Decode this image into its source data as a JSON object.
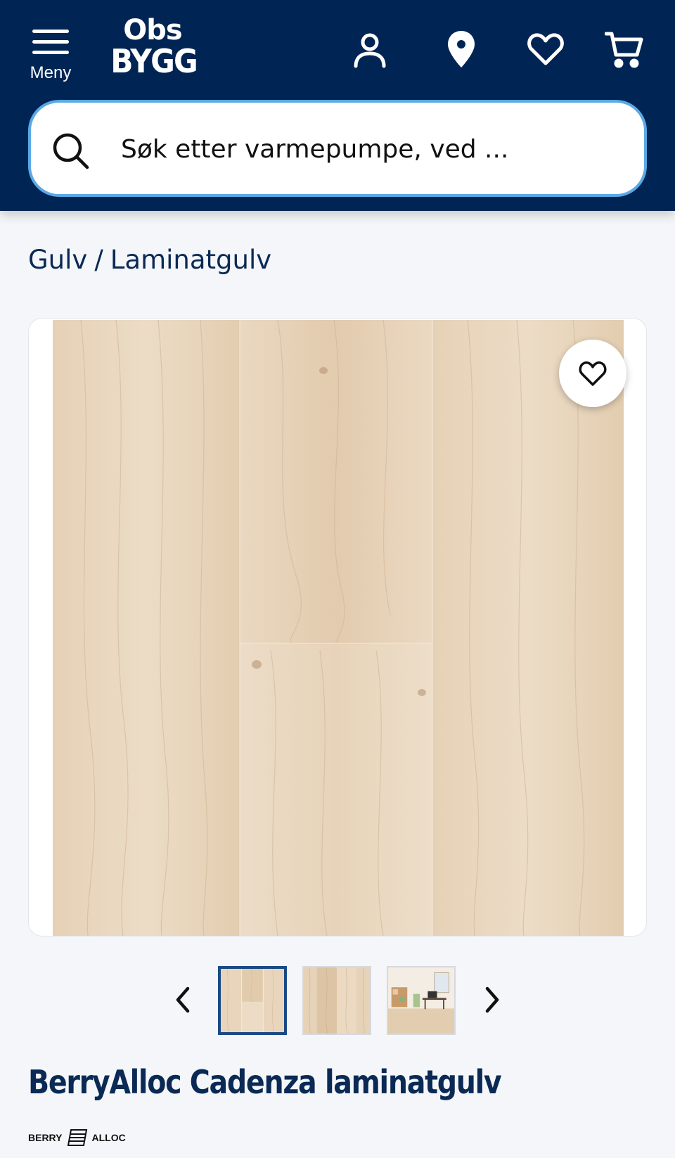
{
  "header": {
    "menu_label": "Meny",
    "logo_top": "Obs",
    "logo_bottom": "BYGG",
    "icons": [
      "user-icon",
      "location-pin-icon",
      "heart-icon",
      "cart-icon"
    ],
    "background_color": "#002554"
  },
  "search": {
    "placeholder": "Søk etter varmepumpe, ved ...",
    "border_color": "#5aa9e6"
  },
  "breadcrumb": {
    "items": [
      "Gulv",
      "Laminatgulv"
    ],
    "separator": "/"
  },
  "gallery": {
    "thumbnails_count_visible": 3,
    "active_thumbnail": 1
  },
  "product": {
    "title": "BerryAlloc Cadenza laminatgulv",
    "brand_left": "BERRY",
    "brand_right": "ALLOC"
  },
  "colors": {
    "brand_navy": "#002554",
    "text_navy": "#0a2a55",
    "wood_light": "#e9d6bd"
  }
}
